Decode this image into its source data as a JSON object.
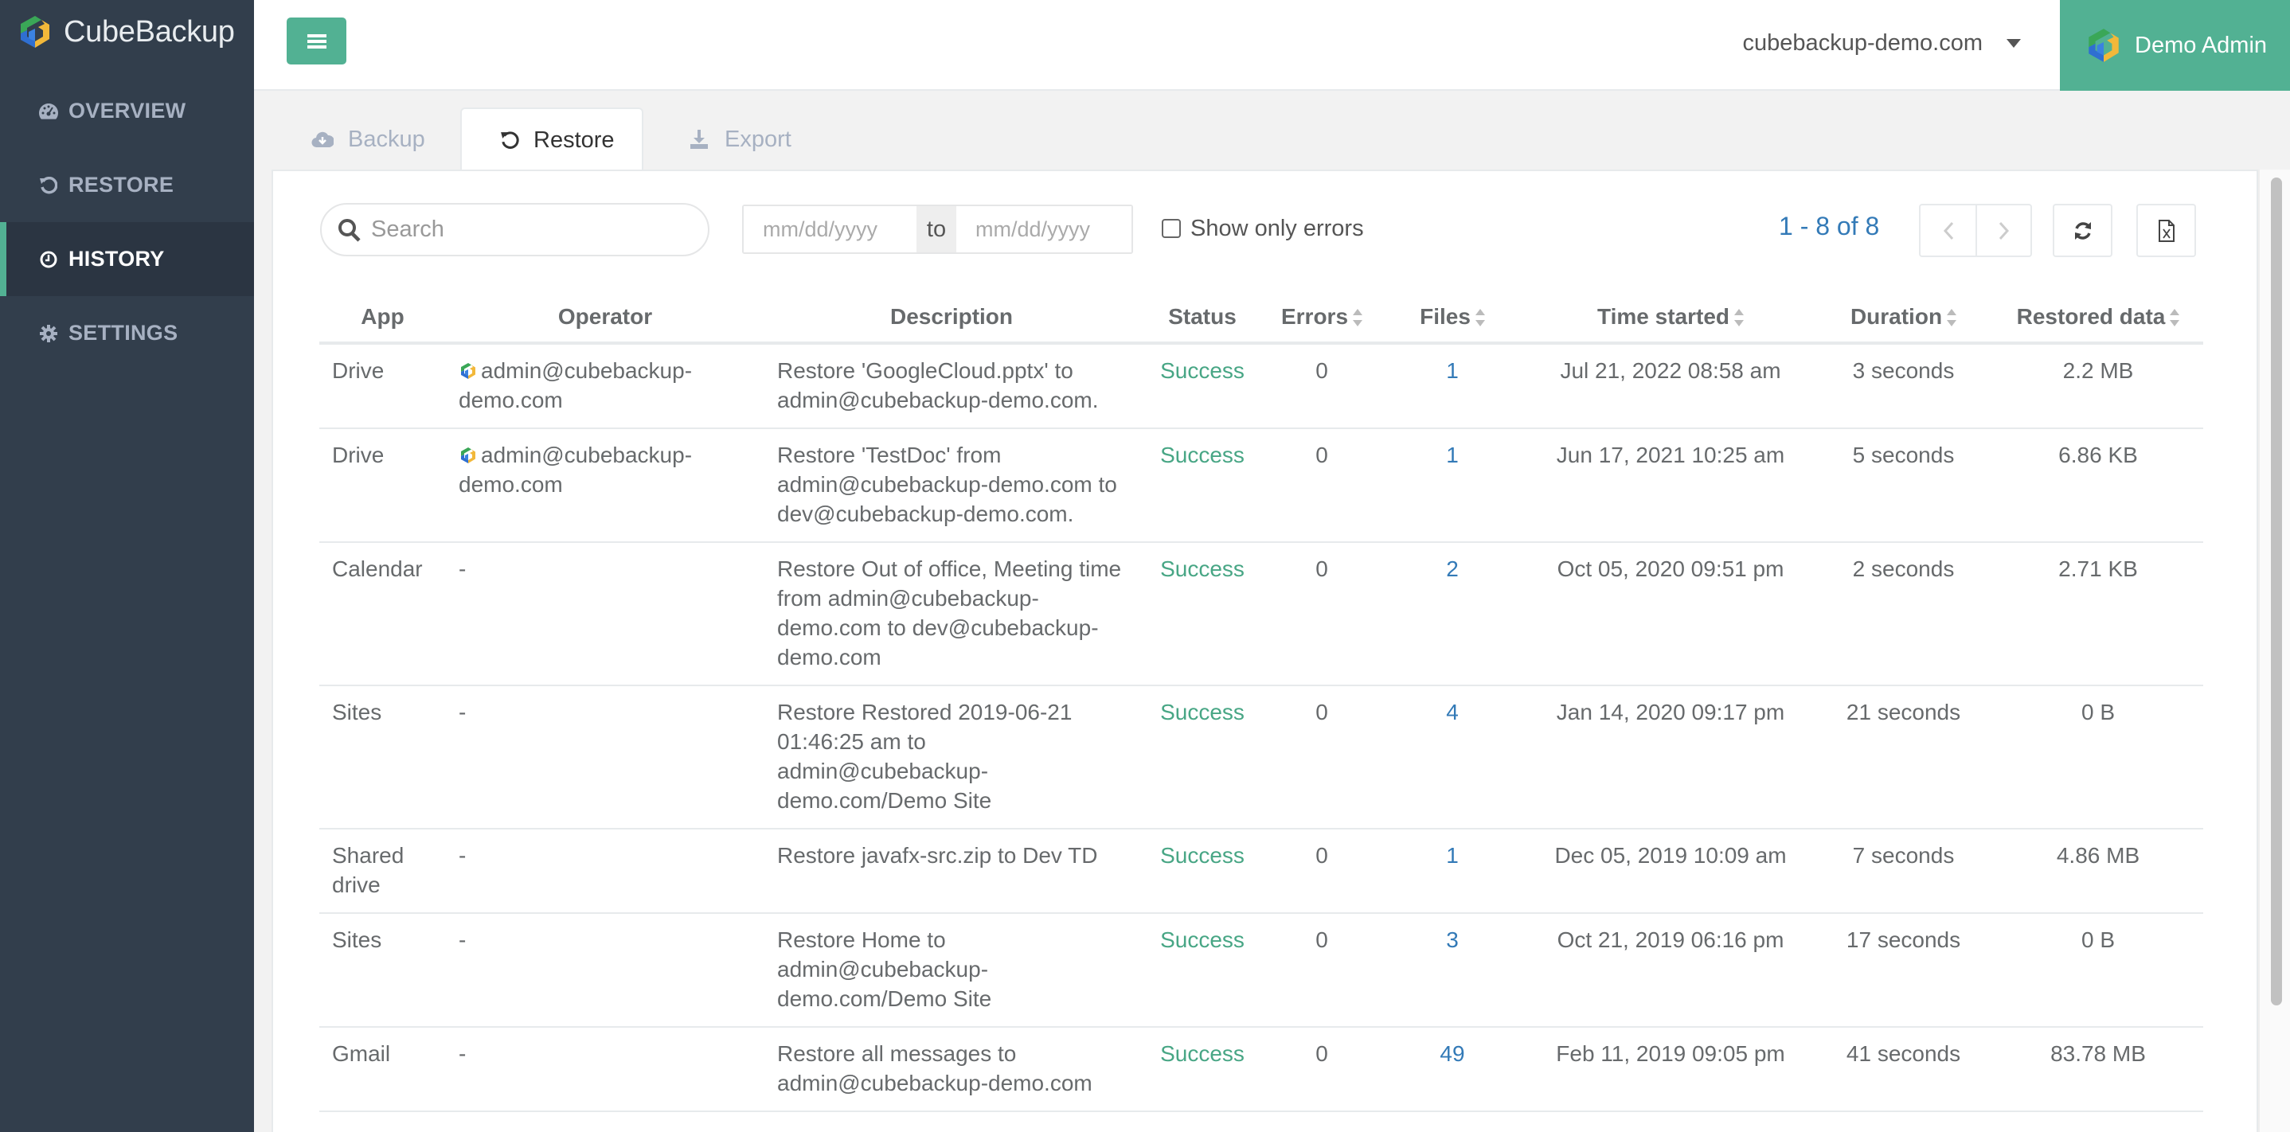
{
  "app": {
    "name": "CubeBackup",
    "brand_color": "#52b193",
    "sidebar_color": "#323e4c"
  },
  "sidebar": {
    "items": [
      {
        "label": "OVERVIEW",
        "icon": "dashboard-icon",
        "active": false
      },
      {
        "label": "RESTORE",
        "icon": "restore-icon",
        "active": false
      },
      {
        "label": "HISTORY",
        "icon": "clock-icon",
        "active": true
      },
      {
        "label": "SETTINGS",
        "icon": "gear-icon",
        "active": false
      }
    ]
  },
  "header": {
    "menu_icon": "hamburger-icon",
    "domain": "cubebackup-demo.com",
    "user": "Demo Admin"
  },
  "tabs": [
    {
      "label": "Backup",
      "icon": "cloud-download-icon",
      "active": false
    },
    {
      "label": "Restore",
      "icon": "restore-icon",
      "active": true
    },
    {
      "label": "Export",
      "icon": "download-icon",
      "active": false
    }
  ],
  "filters": {
    "search_placeholder": "Search",
    "date_from_placeholder": "mm/dd/yyyy",
    "date_separator": "to",
    "date_to_placeholder": "mm/dd/yyyy",
    "show_only_errors_label": "Show only errors",
    "show_only_errors_checked": false
  },
  "pagination": {
    "info": "1 - 8 of 8"
  },
  "table": {
    "columns": [
      "App",
      "Operator",
      "Description",
      "Status",
      "Errors",
      "Files",
      "Time started",
      "Duration",
      "Restored data"
    ],
    "sortable": [
      false,
      false,
      false,
      false,
      true,
      true,
      true,
      true,
      true
    ],
    "rows": [
      {
        "app": "Drive",
        "operator": "admin@cubebackup-demo.com",
        "operator_has_icon": true,
        "description": "Restore 'GoogleCloud.pptx' to admin@cubebackup-demo.com.",
        "status": "Success",
        "errors": "0",
        "files": "1",
        "time_started": "Jul 21, 2022 08:58 am",
        "duration": "3 seconds",
        "restored_data": "2.2 MB"
      },
      {
        "app": "Drive",
        "operator": "admin@cubebackup-demo.com",
        "operator_has_icon": true,
        "description": "Restore 'TestDoc' from admin@cubebackup-demo.com to dev@cubebackup-demo.com.",
        "status": "Success",
        "errors": "0",
        "files": "1",
        "time_started": "Jun 17, 2021 10:25 am",
        "duration": "5 seconds",
        "restored_data": "6.86 KB"
      },
      {
        "app": "Calendar",
        "operator": "-",
        "operator_has_icon": false,
        "description": "Restore Out of office, Meeting time from admin@cubebackup-demo.com to dev@cubebackup-demo.com",
        "status": "Success",
        "errors": "0",
        "files": "2",
        "time_started": "Oct 05, 2020 09:51 pm",
        "duration": "2 seconds",
        "restored_data": "2.71 KB"
      },
      {
        "app": "Sites",
        "operator": "-",
        "operator_has_icon": false,
        "description": "Restore Restored 2019-06-21 01:46:25 am to admin@cubebackup-demo.com/Demo Site",
        "status": "Success",
        "errors": "0",
        "files": "4",
        "time_started": "Jan 14, 2020 09:17 pm",
        "duration": "21 seconds",
        "restored_data": "0 B"
      },
      {
        "app": "Shared drive",
        "operator": "-",
        "operator_has_icon": false,
        "description": "Restore javafx-src.zip to Dev TD",
        "status": "Success",
        "errors": "0",
        "files": "1",
        "time_started": "Dec 05, 2019 10:09 am",
        "duration": "7 seconds",
        "restored_data": "4.86 MB"
      },
      {
        "app": "Sites",
        "operator": "-",
        "operator_has_icon": false,
        "description": "Restore Home to admin@cubebackup-demo.com/Demo Site",
        "status": "Success",
        "errors": "0",
        "files": "3",
        "time_started": "Oct 21, 2019 06:16 pm",
        "duration": "17 seconds",
        "restored_data": "0 B"
      },
      {
        "app": "Gmail",
        "operator": "-",
        "operator_has_icon": false,
        "description": "Restore all messages to admin@cubebackup-demo.com",
        "status": "Success",
        "errors": "0",
        "files": "49",
        "time_started": "Feb 11, 2019 09:05 pm",
        "duration": "41 seconds",
        "restored_data": "83.78 MB"
      }
    ]
  },
  "colors": {
    "success": "#48a685",
    "link": "#337ab7"
  }
}
